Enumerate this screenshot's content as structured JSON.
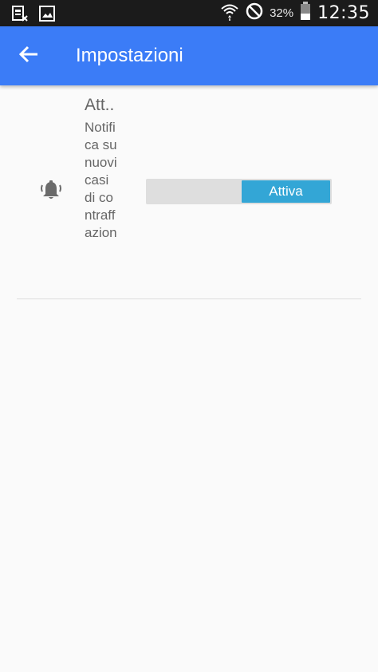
{
  "status_bar": {
    "battery_percent": "32%",
    "time": "12:35",
    "left_icons": [
      "sim-error-icon",
      "image-icon"
    ],
    "right_icons": [
      "wifi-icon",
      "do-not-disturb-icon",
      "battery-icon"
    ]
  },
  "app_bar": {
    "title": "Impostazioni",
    "back_icon": "arrow-back-icon",
    "color": "#3b7cf7"
  },
  "settings": [
    {
      "icon": "bell-ring-icon",
      "title": "Att..",
      "description": "Notifica su nuovi casi di contraffazion",
      "toggle": {
        "state": "on",
        "label": "Attiva",
        "on_color": "#33a6d6",
        "off_color": "#dedede"
      }
    }
  ]
}
